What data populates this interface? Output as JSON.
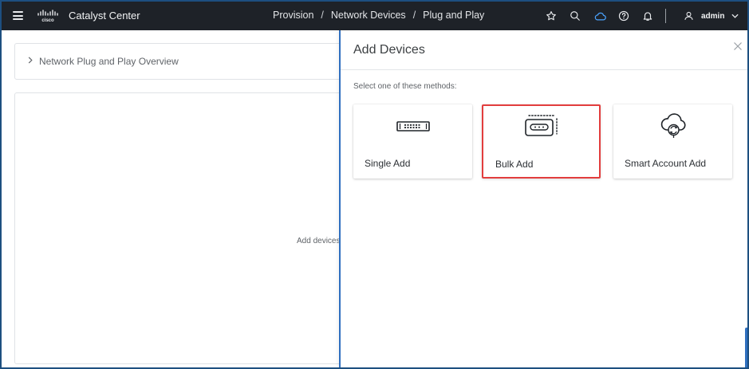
{
  "app": {
    "brand": "cisco",
    "title": "Catalyst Center"
  },
  "breadcrumb": [
    "Provision",
    "Network Devices",
    "Plug and Play"
  ],
  "user": {
    "name": "admin"
  },
  "background": {
    "overview_label": "Network Plug and Play Overview",
    "empty_hint": "Add devices"
  },
  "drawer": {
    "title": "Add Devices",
    "subtitle": "Select one of these methods:",
    "methods": [
      {
        "label": "Single Add",
        "icon": "device-icon",
        "selected": false
      },
      {
        "label": "Bulk Add",
        "icon": "bulk-device-icon",
        "selected": true
      },
      {
        "label": "Smart Account Add",
        "icon": "cloud-sync-icon",
        "selected": false
      }
    ]
  },
  "colors": {
    "topbar": "#1e2228",
    "accent": "#2f6fbf",
    "selected_border": "#e23d3d"
  }
}
